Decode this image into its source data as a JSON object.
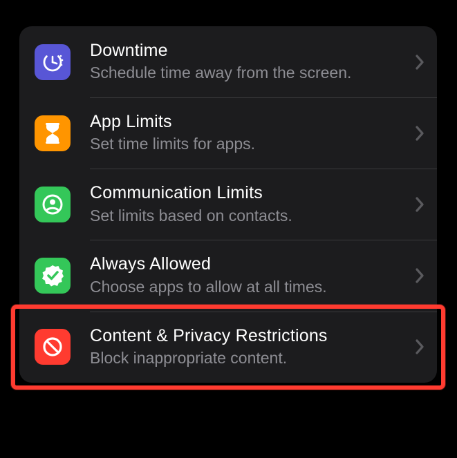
{
  "items": [
    {
      "id": "downtime",
      "title": "Downtime",
      "subtitle": "Schedule time away from the screen.",
      "icon_name": "downtime-icon",
      "icon_bg": "#5856d6",
      "highlighted": false
    },
    {
      "id": "app-limits",
      "title": "App Limits",
      "subtitle": "Set time limits for apps.",
      "icon_name": "hourglass-icon",
      "icon_bg": "#ff9500",
      "highlighted": false
    },
    {
      "id": "communication-limits",
      "title": "Communication Limits",
      "subtitle": "Set limits based on contacts.",
      "icon_name": "person-circle-icon",
      "icon_bg": "#34c759",
      "highlighted": false
    },
    {
      "id": "always-allowed",
      "title": "Always Allowed",
      "subtitle": "Choose apps to allow at all times.",
      "icon_name": "check-seal-icon",
      "icon_bg": "#34c759",
      "highlighted": false
    },
    {
      "id": "content-privacy",
      "title": "Content & Privacy Restrictions",
      "subtitle": "Block inappropriate content.",
      "icon_name": "prohibit-icon",
      "icon_bg": "#ff3b30",
      "highlighted": true
    }
  ],
  "highlight_color": "#ff3b30"
}
